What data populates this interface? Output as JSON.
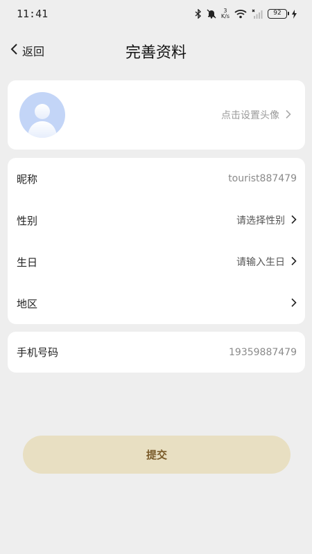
{
  "status_bar": {
    "time": "11:41",
    "speed_value": "3",
    "speed_unit": "K/s",
    "battery": "92"
  },
  "header": {
    "back_label": "返回",
    "title": "完善资料"
  },
  "avatar_section": {
    "hint": "点击设置头像"
  },
  "profile": {
    "nickname_label": "昵称",
    "nickname_value": "tourist887479",
    "gender_label": "性别",
    "gender_placeholder": "请选择性别",
    "birthday_label": "生日",
    "birthday_placeholder": "请输入生日",
    "region_label": "地区",
    "phone_label": "手机号码",
    "phone_value": "19359887479"
  },
  "submit_label": "提交",
  "colors": {
    "background": "#eeeeee",
    "card": "#ffffff",
    "submit_bg": "#e8dfc2",
    "submit_text": "#7a5b2a",
    "avatar_bg": "#c3d5f7"
  }
}
